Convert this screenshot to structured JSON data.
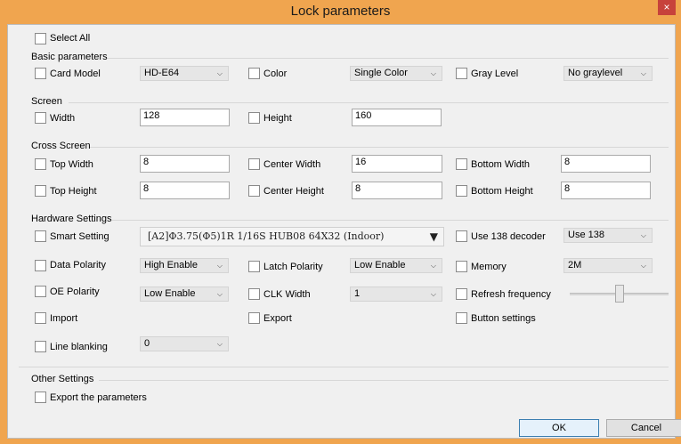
{
  "window": {
    "title": "Lock parameters",
    "close_glyph": "×",
    "accent_color": "#f0a54f",
    "close_color": "#c7423b"
  },
  "select_all": {
    "label": "Select All",
    "checked": false
  },
  "basic": {
    "title": "Basic parameters",
    "card_model": {
      "label": "Card Model",
      "value": "HD-E64"
    },
    "color": {
      "label": "Color",
      "value": "Single Color"
    },
    "gray_level": {
      "label": "Gray Level",
      "value": "No graylevel"
    }
  },
  "screen": {
    "title": "Screen",
    "width": {
      "label": "Width",
      "value": "128"
    },
    "height": {
      "label": "Height",
      "value": "160"
    }
  },
  "cross": {
    "title": "Cross Screen",
    "top_width": {
      "label": "Top Width",
      "value": "8"
    },
    "center_width": {
      "label": "Center Width",
      "value": "16"
    },
    "bottom_width": {
      "label": "Bottom Width",
      "value": "8"
    },
    "top_height": {
      "label": "Top Height",
      "value": "8"
    },
    "center_height": {
      "label": "Center Height",
      "value": "8"
    },
    "bottom_height": {
      "label": "Bottom Height",
      "value": "8"
    }
  },
  "hardware": {
    "title": "Hardware Settings",
    "smart_setting": {
      "label": "Smart Setting",
      "value": "[A2]Φ3.75(Φ5)1R     1/16S HUB08 64X32 (Indoor)"
    },
    "use_138": {
      "label": "Use 138 decoder",
      "value": "Use 138"
    },
    "data_polarity": {
      "label": "Data Polarity",
      "value": "High Enable"
    },
    "latch_polarity": {
      "label": "Latch Polarity",
      "value": "Low Enable"
    },
    "memory": {
      "label": "Memory",
      "value": "2M"
    },
    "oe_polarity": {
      "label": "OE Polarity",
      "value": "Low Enable"
    },
    "clk_width": {
      "label": "CLK Width",
      "value": "1"
    },
    "refresh": {
      "label": "Refresh frequency",
      "level": 0.5
    },
    "import": {
      "label": "Import"
    },
    "export": {
      "label": "Export"
    },
    "button_settings": {
      "label": "Button settings"
    },
    "line_blanking": {
      "label": "Line blanking",
      "value": "0"
    }
  },
  "other": {
    "title": "Other Settings",
    "export_params": {
      "label": "Export the parameters"
    }
  },
  "buttons": {
    "ok": "OK",
    "cancel": "Cancel"
  },
  "icons": {
    "dropdown": "chevron-down-icon",
    "smart_dropdown": "triangle-down-icon"
  }
}
